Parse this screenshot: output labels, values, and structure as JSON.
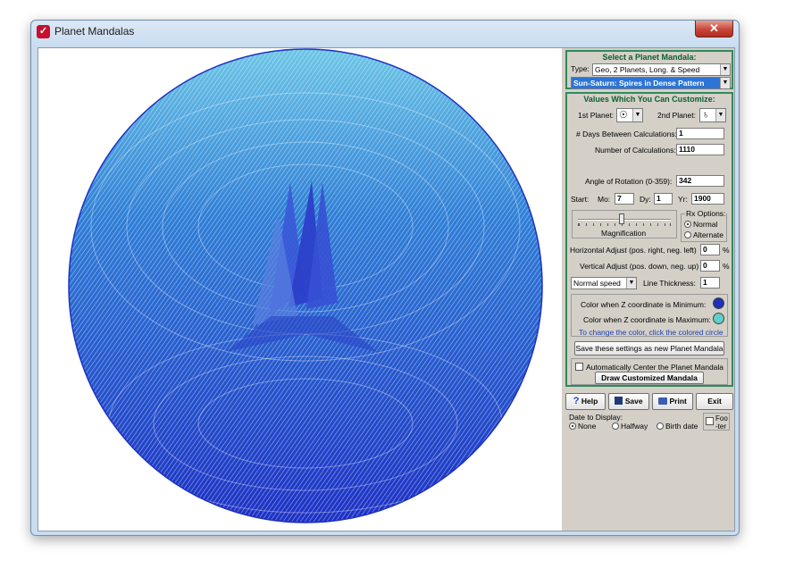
{
  "window": {
    "title": "Planet Mandalas",
    "close_label": "✕"
  },
  "select_group": {
    "title": "Select a Planet Mandala:",
    "type_label": "Type:",
    "type_value": "Geo, 2 Planets, Long. & Speed",
    "mandala_value": "Sun-Saturn: Spires in Dense Pattern"
  },
  "custom_group": {
    "title": "Values Which You Can Customize:",
    "planet1_label": "1st Planet:",
    "planet1_glyph": "☉",
    "planet2_label": "2nd Planet:",
    "planet2_glyph": "♄",
    "days_label": "# Days Between Calculations:",
    "days_value": "1",
    "calcs_label": "Number of Calculations:",
    "calcs_value": "1110",
    "rotation_label": "Angle of Rotation (0-359):",
    "rotation_value": "342",
    "start_label": "Start:",
    "mo_label": "Mo:",
    "mo_value": "7",
    "dy_label": "Dy:",
    "dy_value": "1",
    "yr_label": "Yr:",
    "yr_value": "1900",
    "magnification_label": "Magnification",
    "rx_label": "Rx Options:",
    "rx_normal": "Normal",
    "rx_alternate": "Alternate",
    "hadjust_label": "Horizontal Adjust (pos. right,  neg. left)",
    "hadjust_value": "0",
    "vadjust_label": "Vertical Adjust (pos. down,  neg. up)",
    "vadjust_value": "0",
    "percent": "%",
    "speed_value": "Normal speed",
    "thickness_label": "Line Thickness:",
    "thickness_value": "1",
    "color_min_label": "Color when Z coordinate is Minimum:",
    "color_max_label": "Color when Z coordinate is Maximum:",
    "color_hint": "To change the color,  click the colored circle",
    "color_min": "#1f2fb8",
    "color_max": "#62d0c8",
    "save_settings_label": "Save these settings as new Planet Mandala",
    "auto_center_label": "Automatically Center the Planet Mandala",
    "draw_label": "Draw Customized Mandala"
  },
  "toolbar": {
    "help_label": "Help",
    "save_label": "Save",
    "print_label": "Print",
    "exit_label": "Exit"
  },
  "date_display": {
    "label": "Date to Display:",
    "none": "None",
    "halfway": "Halfway",
    "birth": "Birth date",
    "footer": "Foo-ter"
  }
}
